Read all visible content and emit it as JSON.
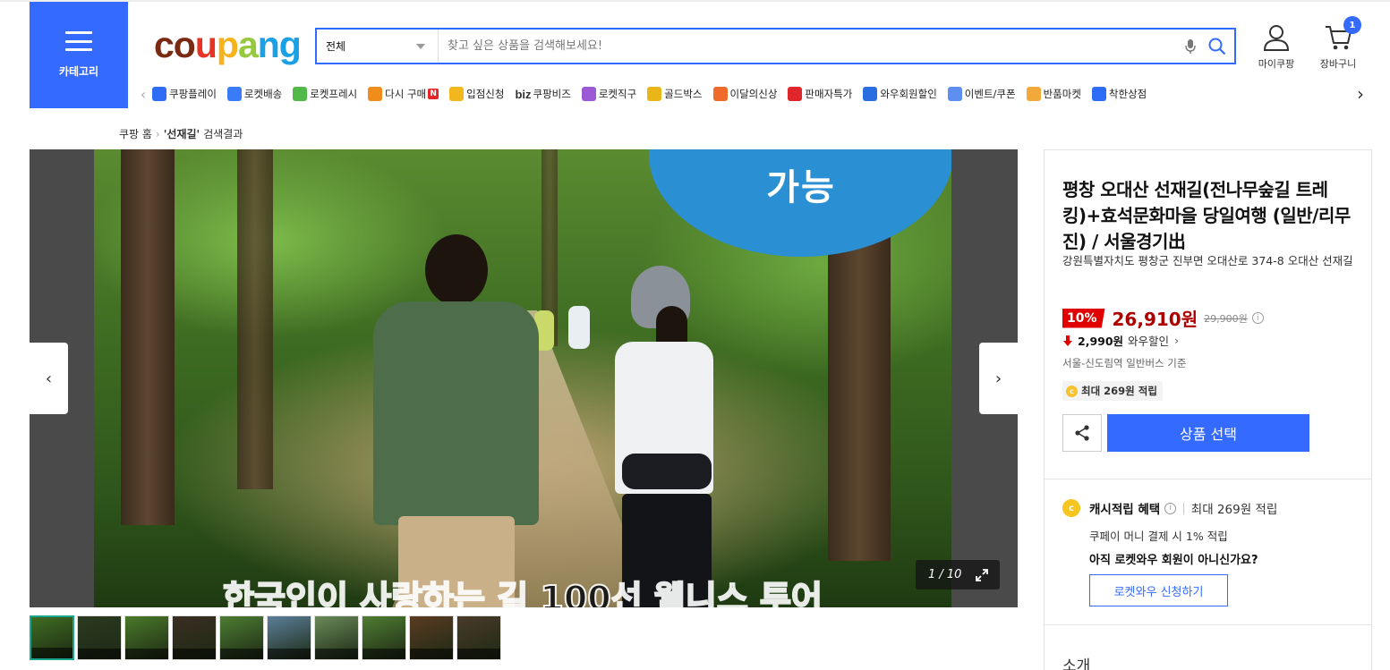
{
  "header": {
    "category_label": "카테고리",
    "logo": {
      "c1": "co",
      "c2": "u",
      "c3": "p",
      "c4": "a",
      "c5": "ng"
    },
    "search_category": "전체",
    "search_placeholder": "찾고 싶은 상품을 검색해보세요!",
    "mycoupang_label": "마이쿠팡",
    "cart_label": "장바구니",
    "cart_count": "1",
    "brand_color": "#346aff"
  },
  "nav": {
    "items": [
      {
        "label": "쿠팡플레이",
        "icon": "play-icon",
        "color": "#2f6cf6"
      },
      {
        "label": "로켓배송",
        "icon": "rocket-icon",
        "color": "#3a7bf7"
      },
      {
        "label": "로켓프레시",
        "icon": "fresh-rocket-icon",
        "color": "#52b848"
      },
      {
        "label": "다시 구매",
        "icon": "basket-icon",
        "color": "#f08c1a",
        "badge": "N"
      },
      {
        "label": "입점신청",
        "icon": "store-icon",
        "color": "#f2b71c"
      },
      {
        "label": "쿠팡비즈",
        "icon": "biz-icon",
        "color": "#333333",
        "prefix": "biz"
      },
      {
        "label": "로켓직구",
        "icon": "direct-rocket-icon",
        "color": "#9b59d6"
      },
      {
        "label": "골드박스",
        "icon": "gold-box-icon",
        "color": "#e9b61a"
      },
      {
        "label": "이달의신상",
        "icon": "new-icon",
        "color": "#f06a2b"
      },
      {
        "label": "판매자특가",
        "icon": "percent-icon",
        "color": "#e0262b"
      },
      {
        "label": "와우회원할인",
        "icon": "wow-icon",
        "color": "#2a6de0"
      },
      {
        "label": "이벤트/쿠폰",
        "icon": "coupon-icon",
        "color": "#5c8ff0"
      },
      {
        "label": "반품마켓",
        "icon": "return-market-icon",
        "color": "#f2a93a"
      },
      {
        "label": "착한상점",
        "icon": "good-store-icon",
        "color": "#2f6cf6"
      }
    ]
  },
  "breadcrumb": {
    "home": "쿠팡 홈",
    "keyword": "'선재길'",
    "suffix": "검색결과"
  },
  "gallery": {
    "badge_text": "가능",
    "bottom_text": "한국인이 사랑하는 길 100선 웰니스 투어",
    "counter": "1 / 10",
    "thumb_count": 10
  },
  "product": {
    "title": "평창 오대산 선재길(전나무숲길 트레킹)+효석문화마을 당일여행 (일반/리무진) / 서울경기出",
    "address": "강원특별자치도 평창군 진부면 오대산로 374-8 오대산 선재길",
    "discount": "10%",
    "price": "26,910원",
    "original_price": "29,900원",
    "wow_amount": "2,990원",
    "wow_label": "와우할인",
    "bus_note": "서울-신도림역 일반버스 기준",
    "reward": "최대 269원 적립",
    "select_label": "상품 선택",
    "cash_title": "캐시적립 혜택",
    "cash_max": "최대 269원 적립",
    "pay_note": "쿠페이 머니 결제 시 1% 적립",
    "not_member": "아직 로켓와우 회원이 아니신가요?",
    "wow_apply": "로켓와우 신청하기",
    "intro": "소개",
    "price_color": "#ae0000",
    "discount_color": "#e10000"
  }
}
